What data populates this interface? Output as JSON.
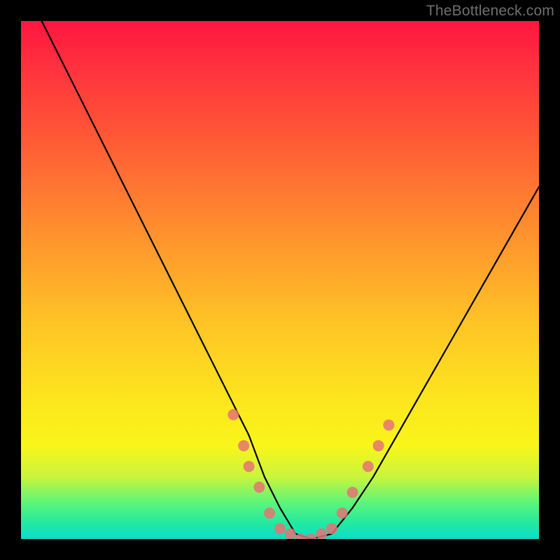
{
  "watermark": "TheBottleneck.com",
  "chart_data": {
    "type": "line",
    "title": "",
    "xlabel": "",
    "ylabel": "",
    "xlim": [
      0,
      100
    ],
    "ylim": [
      0,
      100
    ],
    "curve": {
      "name": "bottleneck-curve",
      "x": [
        4,
        8,
        12,
        16,
        20,
        24,
        28,
        32,
        36,
        40,
        44,
        47,
        50,
        53,
        56,
        60,
        64,
        68,
        72,
        76,
        80,
        84,
        88,
        92,
        96,
        100
      ],
      "y": [
        100,
        92,
        84,
        76,
        68,
        60,
        52,
        44,
        36,
        28,
        20,
        12,
        6,
        1,
        0,
        1,
        6,
        12,
        19,
        26,
        33,
        40,
        47,
        54,
        61,
        68
      ]
    },
    "markers": {
      "name": "highlighted-points",
      "color": "#e57373",
      "radius_px": 8,
      "points": [
        {
          "x": 41,
          "y": 24
        },
        {
          "x": 43,
          "y": 18
        },
        {
          "x": 44,
          "y": 14
        },
        {
          "x": 46,
          "y": 10
        },
        {
          "x": 48,
          "y": 5
        },
        {
          "x": 50,
          "y": 2
        },
        {
          "x": 52,
          "y": 1
        },
        {
          "x": 54,
          "y": 0
        },
        {
          "x": 56,
          "y": 0
        },
        {
          "x": 58,
          "y": 1
        },
        {
          "x": 60,
          "y": 2
        },
        {
          "x": 62,
          "y": 5
        },
        {
          "x": 64,
          "y": 9
        },
        {
          "x": 67,
          "y": 14
        },
        {
          "x": 69,
          "y": 18
        },
        {
          "x": 71,
          "y": 22
        }
      ]
    }
  }
}
